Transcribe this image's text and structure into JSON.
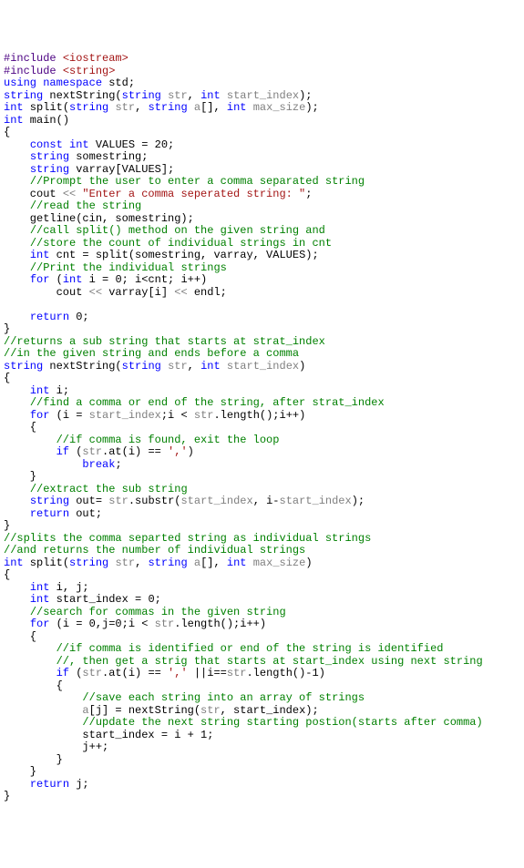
{
  "lines": [
    [
      {
        "c": "pp",
        "t": "#include "
      },
      {
        "c": "inc",
        "t": "<iostream>"
      }
    ],
    [
      {
        "c": "pp",
        "t": "#include "
      },
      {
        "c": "inc",
        "t": "<string>"
      }
    ],
    [
      {
        "c": "kw",
        "t": "using"
      },
      {
        "t": " "
      },
      {
        "c": "kw",
        "t": "namespace"
      },
      {
        "t": " std;"
      }
    ],
    [
      {
        "c": "kw",
        "t": "string"
      },
      {
        "t": " nextString("
      },
      {
        "c": "kw",
        "t": "string"
      },
      {
        "t": " "
      },
      {
        "c": "id",
        "t": "str"
      },
      {
        "t": ", "
      },
      {
        "c": "kw",
        "t": "int"
      },
      {
        "t": " "
      },
      {
        "c": "id",
        "t": "start_index"
      },
      {
        "t": ");"
      }
    ],
    [
      {
        "c": "kw",
        "t": "int"
      },
      {
        "t": " split("
      },
      {
        "c": "kw",
        "t": "string"
      },
      {
        "t": " "
      },
      {
        "c": "id",
        "t": "str"
      },
      {
        "t": ", "
      },
      {
        "c": "kw",
        "t": "string"
      },
      {
        "t": " "
      },
      {
        "c": "id",
        "t": "a"
      },
      {
        "t": "[], "
      },
      {
        "c": "kw",
        "t": "int"
      },
      {
        "t": " "
      },
      {
        "c": "id",
        "t": "max_size"
      },
      {
        "t": ");"
      }
    ],
    [
      {
        "c": "kw",
        "t": "int"
      },
      {
        "t": " main()"
      }
    ],
    [
      {
        "t": "{"
      }
    ],
    [
      {
        "t": "    "
      },
      {
        "c": "kw",
        "t": "const"
      },
      {
        "t": " "
      },
      {
        "c": "kw",
        "t": "int"
      },
      {
        "t": " VALUES = 20;"
      }
    ],
    [
      {
        "t": "    "
      },
      {
        "c": "kw",
        "t": "string"
      },
      {
        "t": " somestring;"
      }
    ],
    [
      {
        "t": "    "
      },
      {
        "c": "kw",
        "t": "string"
      },
      {
        "t": " varray[VALUES];"
      }
    ],
    [
      {
        "t": "    "
      },
      {
        "c": "cmt",
        "t": "//Prompt the user to enter a comma separated string"
      }
    ],
    [
      {
        "t": "    cout "
      },
      {
        "c": "id",
        "t": "<<"
      },
      {
        "t": " "
      },
      {
        "c": "str",
        "t": "\"Enter a comma seperated string: \""
      },
      {
        "t": ";"
      }
    ],
    [
      {
        "t": "    "
      },
      {
        "c": "cmt",
        "t": "//read the string"
      }
    ],
    [
      {
        "t": "    getline(cin, somestring);"
      }
    ],
    [
      {
        "t": "    "
      },
      {
        "c": "cmt",
        "t": "//call split() method on the given string and"
      }
    ],
    [
      {
        "t": "    "
      },
      {
        "c": "cmt",
        "t": "//store the count of individual strings in cnt"
      }
    ],
    [
      {
        "t": "    "
      },
      {
        "c": "kw",
        "t": "int"
      },
      {
        "t": " cnt = split(somestring, varray, VALUES);"
      }
    ],
    [
      {
        "t": "    "
      },
      {
        "c": "cmt",
        "t": "//Print the individual strings"
      }
    ],
    [
      {
        "t": "    "
      },
      {
        "c": "kw",
        "t": "for"
      },
      {
        "t": " ("
      },
      {
        "c": "kw",
        "t": "int"
      },
      {
        "t": " i = 0; i<cnt; i++)"
      }
    ],
    [
      {
        "t": "        cout "
      },
      {
        "c": "id",
        "t": "<<"
      },
      {
        "t": " varray[i] "
      },
      {
        "c": "id",
        "t": "<<"
      },
      {
        "t": " endl;"
      }
    ],
    [
      {
        "t": ""
      }
    ],
    [
      {
        "t": "    "
      },
      {
        "c": "kw",
        "t": "return"
      },
      {
        "t": " 0;"
      }
    ],
    [
      {
        "t": "}"
      }
    ],
    [
      {
        "c": "cmt",
        "t": "//returns a sub string that starts at strat_index"
      }
    ],
    [
      {
        "c": "cmt",
        "t": "//in the given string and ends before a comma"
      }
    ],
    [
      {
        "c": "kw",
        "t": "string"
      },
      {
        "t": " nextString("
      },
      {
        "c": "kw",
        "t": "string"
      },
      {
        "t": " "
      },
      {
        "c": "id",
        "t": "str"
      },
      {
        "t": ", "
      },
      {
        "c": "kw",
        "t": "int"
      },
      {
        "t": " "
      },
      {
        "c": "id",
        "t": "start_index"
      },
      {
        "t": ")"
      }
    ],
    [
      {
        "t": "{"
      }
    ],
    [
      {
        "t": "    "
      },
      {
        "c": "kw",
        "t": "int"
      },
      {
        "t": " i;"
      }
    ],
    [
      {
        "t": "    "
      },
      {
        "c": "cmt",
        "t": "//find a comma or end of the string, after strat_index"
      }
    ],
    [
      {
        "t": "    "
      },
      {
        "c": "kw",
        "t": "for"
      },
      {
        "t": " (i = "
      },
      {
        "c": "id",
        "t": "start_index"
      },
      {
        "t": ";i < "
      },
      {
        "c": "id",
        "t": "str"
      },
      {
        "t": ".length();i++)"
      }
    ],
    [
      {
        "t": "    {"
      }
    ],
    [
      {
        "t": "        "
      },
      {
        "c": "cmt",
        "t": "//if comma is found, exit the loop"
      }
    ],
    [
      {
        "t": "        "
      },
      {
        "c": "kw",
        "t": "if"
      },
      {
        "t": " ("
      },
      {
        "c": "id",
        "t": "str"
      },
      {
        "t": ".at(i) == "
      },
      {
        "c": "str",
        "t": "','"
      },
      {
        "t": ")"
      }
    ],
    [
      {
        "t": "            "
      },
      {
        "c": "kw",
        "t": "break"
      },
      {
        "t": ";"
      }
    ],
    [
      {
        "t": "    }"
      }
    ],
    [
      {
        "t": "    "
      },
      {
        "c": "cmt",
        "t": "//extract the sub string"
      }
    ],
    [
      {
        "t": "    "
      },
      {
        "c": "kw",
        "t": "string"
      },
      {
        "t": " out= "
      },
      {
        "c": "id",
        "t": "str"
      },
      {
        "t": ".substr("
      },
      {
        "c": "id",
        "t": "start_index"
      },
      {
        "t": ", i-"
      },
      {
        "c": "id",
        "t": "start_index"
      },
      {
        "t": ");"
      }
    ],
    [
      {
        "t": "    "
      },
      {
        "c": "kw",
        "t": "return"
      },
      {
        "t": " out;"
      }
    ],
    [
      {
        "t": "}"
      }
    ],
    [
      {
        "c": "cmt",
        "t": "//splits the comma separted string as individual strings"
      }
    ],
    [
      {
        "c": "cmt",
        "t": "//and returns the number of individual strings"
      }
    ],
    [
      {
        "c": "kw",
        "t": "int"
      },
      {
        "t": " split("
      },
      {
        "c": "kw",
        "t": "string"
      },
      {
        "t": " "
      },
      {
        "c": "id",
        "t": "str"
      },
      {
        "t": ", "
      },
      {
        "c": "kw",
        "t": "string"
      },
      {
        "t": " "
      },
      {
        "c": "id",
        "t": "a"
      },
      {
        "t": "[], "
      },
      {
        "c": "kw",
        "t": "int"
      },
      {
        "t": " "
      },
      {
        "c": "id",
        "t": "max_size"
      },
      {
        "t": ")"
      }
    ],
    [
      {
        "t": "{"
      }
    ],
    [
      {
        "t": "    "
      },
      {
        "c": "kw",
        "t": "int"
      },
      {
        "t": " i, j;"
      }
    ],
    [
      {
        "t": "    "
      },
      {
        "c": "kw",
        "t": "int"
      },
      {
        "t": " start_index = 0;"
      }
    ],
    [
      {
        "t": "    "
      },
      {
        "c": "cmt",
        "t": "//search for commas in the given string"
      }
    ],
    [
      {
        "t": "    "
      },
      {
        "c": "kw",
        "t": "for"
      },
      {
        "t": " (i = 0,j=0;i < "
      },
      {
        "c": "id",
        "t": "str"
      },
      {
        "t": ".length();i++)"
      }
    ],
    [
      {
        "t": "    {"
      }
    ],
    [
      {
        "t": "        "
      },
      {
        "c": "cmt",
        "t": "//if comma is identified or end of the string is identified"
      }
    ],
    [
      {
        "t": "        "
      },
      {
        "c": "cmt",
        "t": "//, then get a strig that starts at start_index using next string"
      }
    ],
    [
      {
        "t": "        "
      },
      {
        "c": "kw",
        "t": "if"
      },
      {
        "t": " ("
      },
      {
        "c": "id",
        "t": "str"
      },
      {
        "t": ".at(i) == "
      },
      {
        "c": "str",
        "t": "','"
      },
      {
        "t": " ||i=="
      },
      {
        "c": "id",
        "t": "str"
      },
      {
        "t": ".length()-1)"
      }
    ],
    [
      {
        "t": "        {"
      }
    ],
    [
      {
        "t": "            "
      },
      {
        "c": "cmt",
        "t": "//save each string into an array of strings"
      }
    ],
    [
      {
        "t": "            "
      },
      {
        "c": "id",
        "t": "a"
      },
      {
        "t": "[j] = nextString("
      },
      {
        "c": "id",
        "t": "str"
      },
      {
        "t": ", start_index);"
      }
    ],
    [
      {
        "t": "            "
      },
      {
        "c": "cmt",
        "t": "//update the next string starting postion(starts after comma)"
      }
    ],
    [
      {
        "t": "            start_index = i + 1;"
      }
    ],
    [
      {
        "t": "            j++;"
      }
    ],
    [
      {
        "t": "        }"
      }
    ],
    [
      {
        "t": "    }"
      }
    ],
    [
      {
        "t": "    "
      },
      {
        "c": "kw",
        "t": "return"
      },
      {
        "t": " j;"
      }
    ],
    [
      {
        "t": "}"
      }
    ]
  ]
}
